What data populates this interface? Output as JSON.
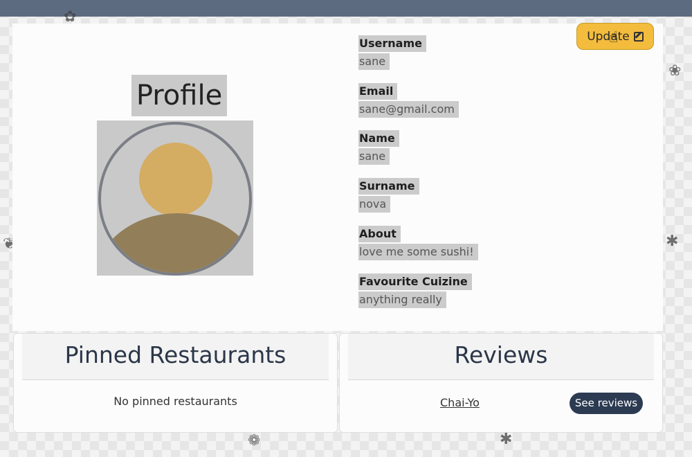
{
  "profile": {
    "title": "Profile",
    "update_label": "Update",
    "fields": [
      {
        "label": "Username",
        "value": "sane"
      },
      {
        "label": "Email",
        "value": "sane@gmail.com"
      },
      {
        "label": "Name",
        "value": "sane"
      },
      {
        "label": "Surname",
        "value": "nova"
      },
      {
        "label": "About",
        "value": "love me some sushi!"
      },
      {
        "label": "Favourite Cuizine",
        "value": "anything really"
      }
    ]
  },
  "pinned": {
    "title": "Pinned Restaurants",
    "empty_text": "No pinned restaurants"
  },
  "reviews": {
    "title": "Reviews",
    "items": [
      {
        "restaurant": "Chai-Yo",
        "button_label": "See reviews"
      }
    ]
  },
  "icons": {
    "avatar": "user-silhouette-icon",
    "update": "edit-icon",
    "cursor": "hand-pointer-icon"
  },
  "colors": {
    "topbar": "#5d6b80",
    "update_button": "#f4bc3d",
    "see_reviews_button": "#2c3b52",
    "avatar_head": "#d4ac62",
    "avatar_body": "#927f5a"
  }
}
